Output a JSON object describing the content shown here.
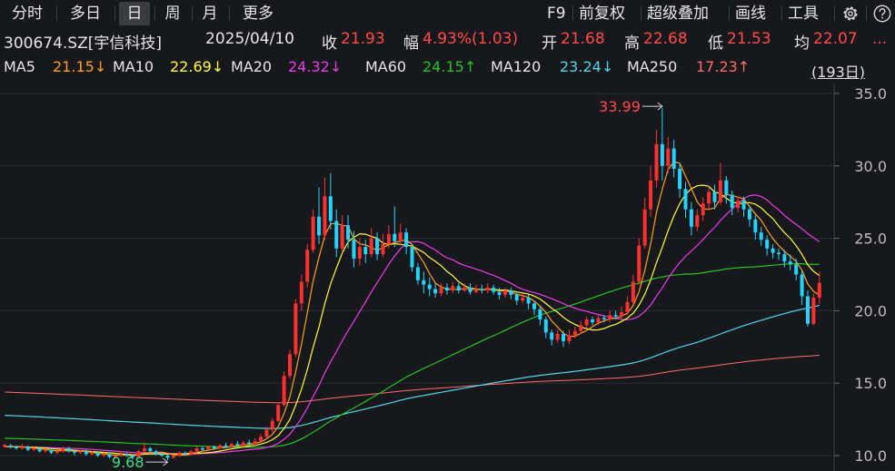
{
  "toolbar": {
    "tabs": [
      {
        "label": "分时",
        "active": false
      },
      {
        "label": "多日",
        "active": false
      },
      {
        "label": "日",
        "active": true
      },
      {
        "label": "周",
        "active": false
      },
      {
        "label": "月",
        "active": false
      },
      {
        "label": "更多",
        "active": false
      }
    ],
    "right": {
      "f9": "F9",
      "adjust": "前复权",
      "overlay": "超级叠加",
      "draw": "画线",
      "tools": "工具",
      "settings_icon": "gear-icon",
      "help_icon": "question-icon"
    }
  },
  "quote": {
    "symbol": "300674.SZ[宇信科技]",
    "date": "2025/04/10",
    "close_label": "收",
    "close": "21.93",
    "change_label": "幅",
    "change": "4.93%(1.03)",
    "open_label": "开",
    "open": "21.68",
    "high_label": "高",
    "high": "22.68",
    "low_label": "低",
    "low": "21.53",
    "avg_label": "均",
    "avg": "22.07",
    "more": "..."
  },
  "ma": [
    {
      "label": "MA5",
      "value": "21.15",
      "dir": "↓",
      "color": "#ff9f1a"
    },
    {
      "label": "MA10",
      "value": "22.69",
      "dir": "↓",
      "color": "#ffff33"
    },
    {
      "label": "MA20",
      "value": "24.32",
      "dir": "↓",
      "color": "#e83ce8"
    },
    {
      "label": "MA60",
      "value": "24.15",
      "dir": "↑",
      "color": "#22c322"
    },
    {
      "label": "MA120",
      "value": "23.24",
      "dir": "↓",
      "color": "#4fd6e8"
    },
    {
      "label": "MA250",
      "value": "17.23",
      "dir": "↑",
      "color": "#ff6b6b"
    }
  ],
  "period_label": "(193日)",
  "colors": {
    "up": "#ff3030",
    "down": "#22d4ff",
    "background": "#17181c",
    "text": "#d9d9d9"
  },
  "chart_data": {
    "type": "candlestick",
    "y_ticks": [
      "35.0",
      "30.0",
      "25.0",
      "20.0",
      "15.0",
      "10.0"
    ],
    "ylim": [
      9.5,
      35.5
    ],
    "max_annotation": "33.99",
    "min_annotation": "9.68",
    "grid": true,
    "candles": [
      [
        10.6,
        10.75,
        10.6,
        10.8
      ],
      [
        10.7,
        10.6,
        10.5,
        10.8
      ],
      [
        10.6,
        10.5,
        10.4,
        10.7
      ],
      [
        10.5,
        10.6,
        10.4,
        10.8
      ],
      [
        10.6,
        10.4,
        10.3,
        10.7
      ],
      [
        10.4,
        10.5,
        10.3,
        10.6
      ],
      [
        10.5,
        10.3,
        10.2,
        10.6
      ],
      [
        10.3,
        10.4,
        10.2,
        10.5
      ],
      [
        10.4,
        10.2,
        10.1,
        10.5
      ],
      [
        10.2,
        10.3,
        10.1,
        10.4
      ],
      [
        10.3,
        10.5,
        10.2,
        10.6
      ],
      [
        10.5,
        10.3,
        10.2,
        10.6
      ],
      [
        10.3,
        10.2,
        10.0,
        10.4
      ],
      [
        10.2,
        10.3,
        10.1,
        10.4
      ],
      [
        10.3,
        10.1,
        10.0,
        10.4
      ],
      [
        10.1,
        10.2,
        10.0,
        10.3
      ],
      [
        10.2,
        10.0,
        9.9,
        10.3
      ],
      [
        10.0,
        10.1,
        9.9,
        10.2
      ],
      [
        10.1,
        9.9,
        9.8,
        10.2
      ],
      [
        9.9,
        10.0,
        9.8,
        10.1
      ],
      [
        10.0,
        10.1,
        9.9,
        10.3
      ],
      [
        10.1,
        10.0,
        9.9,
        10.2
      ],
      [
        10.0,
        9.9,
        9.7,
        10.1
      ],
      [
        9.9,
        10.3,
        9.8,
        10.4
      ],
      [
        10.3,
        10.5,
        10.2,
        10.9
      ],
      [
        10.5,
        10.3,
        10.2,
        10.6
      ],
      [
        10.3,
        10.1,
        10.0,
        10.4
      ],
      [
        10.1,
        10.0,
        9.9,
        10.2
      ],
      [
        10.0,
        9.85,
        9.68,
        10.1
      ],
      [
        9.85,
        10.0,
        9.8,
        10.1
      ],
      [
        10.0,
        10.2,
        9.9,
        10.3
      ],
      [
        10.2,
        10.1,
        10.0,
        10.3
      ],
      [
        10.1,
        10.3,
        10.0,
        10.4
      ],
      [
        10.3,
        10.5,
        10.2,
        10.6
      ],
      [
        10.5,
        10.4,
        10.3,
        10.6
      ],
      [
        10.4,
        10.6,
        10.3,
        10.7
      ],
      [
        10.6,
        10.5,
        10.4,
        10.7
      ],
      [
        10.5,
        10.7,
        10.4,
        10.8
      ],
      [
        10.7,
        10.6,
        10.5,
        10.9
      ],
      [
        10.6,
        10.8,
        10.5,
        10.9
      ],
      [
        10.8,
        10.7,
        10.6,
        11.0
      ],
      [
        10.7,
        10.9,
        10.6,
        11.0
      ],
      [
        10.9,
        10.8,
        10.7,
        11.1
      ],
      [
        10.8,
        11.0,
        10.7,
        11.2
      ],
      [
        11.0,
        11.3,
        10.9,
        11.5
      ],
      [
        11.3,
        11.8,
        11.2,
        12.0
      ],
      [
        11.8,
        12.4,
        11.6,
        12.6
      ],
      [
        12.4,
        13.5,
        12.3,
        13.7
      ],
      [
        13.5,
        15.5,
        13.4,
        15.8
      ],
      [
        15.5,
        17.0,
        15.3,
        17.3
      ],
      [
        17.0,
        20.5,
        16.8,
        20.8
      ],
      [
        20.5,
        22.0,
        20.0,
        22.5
      ],
      [
        22.0,
        24.2,
        21.6,
        24.6
      ],
      [
        24.2,
        26.5,
        24.0,
        27.0
      ],
      [
        26.5,
        25.2,
        24.6,
        28.5
      ],
      [
        25.2,
        27.9,
        24.9,
        29.2
      ],
      [
        27.9,
        26.2,
        25.6,
        29.5
      ],
      [
        26.2,
        24.3,
        23.7,
        27.0
      ],
      [
        24.3,
        25.9,
        24.0,
        26.6
      ],
      [
        25.9,
        24.9,
        24.3,
        26.6
      ],
      [
        24.9,
        23.6,
        23.0,
        25.5
      ],
      [
        23.6,
        24.4,
        23.1,
        25.0
      ],
      [
        24.4,
        23.9,
        23.3,
        24.9
      ],
      [
        23.9,
        25.0,
        23.7,
        25.7
      ],
      [
        25.0,
        23.9,
        23.5,
        25.4
      ],
      [
        23.9,
        24.6,
        23.7,
        25.3
      ],
      [
        24.6,
        25.3,
        24.3,
        25.9
      ],
      [
        25.3,
        24.8,
        24.4,
        27.2
      ],
      [
        24.8,
        25.4,
        24.5,
        26.0
      ],
      [
        25.4,
        24.4,
        23.9,
        25.7
      ],
      [
        24.4,
        23.0,
        22.7,
        24.6
      ],
      [
        23.0,
        22.1,
        21.8,
        23.3
      ],
      [
        22.1,
        21.8,
        21.2,
        22.7
      ],
      [
        21.8,
        21.5,
        21.0,
        22.3
      ],
      [
        21.5,
        21.2,
        20.9,
        21.9
      ],
      [
        21.2,
        21.6,
        21.0,
        21.9
      ],
      [
        21.6,
        21.4,
        21.1,
        21.9
      ],
      [
        21.4,
        21.7,
        21.2,
        22.0
      ],
      [
        21.7,
        21.4,
        21.2,
        21.9
      ],
      [
        21.4,
        21.6,
        21.3,
        21.9
      ],
      [
        21.6,
        21.3,
        21.1,
        21.9
      ],
      [
        21.3,
        21.5,
        21.2,
        21.8
      ],
      [
        21.5,
        21.4,
        21.2,
        21.8
      ],
      [
        21.4,
        21.6,
        21.2,
        21.9
      ],
      [
        21.6,
        21.3,
        21.1,
        21.8
      ],
      [
        21.3,
        21.1,
        20.8,
        21.6
      ],
      [
        21.1,
        21.4,
        20.9,
        21.6
      ],
      [
        21.4,
        21.1,
        20.8,
        21.6
      ],
      [
        21.1,
        20.7,
        20.4,
        21.3
      ],
      [
        20.7,
        20.9,
        20.5,
        21.2
      ],
      [
        20.9,
        20.5,
        20.1,
        21.1
      ],
      [
        20.5,
        20.1,
        19.7,
        20.7
      ],
      [
        20.1,
        19.4,
        19.0,
        20.3
      ],
      [
        19.4,
        18.5,
        18.1,
        19.6
      ],
      [
        18.5,
        18.0,
        17.6,
        18.7
      ],
      [
        18.0,
        18.4,
        17.8,
        18.7
      ],
      [
        18.4,
        17.9,
        17.5,
        18.6
      ],
      [
        17.9,
        18.3,
        17.7,
        18.7
      ],
      [
        18.3,
        18.6,
        18.1,
        18.9
      ],
      [
        18.6,
        19.0,
        18.4,
        19.3
      ],
      [
        19.0,
        19.4,
        18.8,
        19.6
      ],
      [
        19.4,
        19.2,
        19.0,
        19.6
      ],
      [
        19.2,
        19.5,
        19.0,
        19.8
      ],
      [
        19.5,
        19.4,
        19.2,
        19.7
      ],
      [
        19.4,
        19.7,
        19.2,
        20.0
      ],
      [
        19.7,
        19.6,
        19.4,
        20.0
      ],
      [
        19.6,
        19.9,
        19.4,
        20.3
      ],
      [
        19.9,
        20.6,
        19.7,
        21.0
      ],
      [
        20.6,
        22.0,
        20.4,
        22.5
      ],
      [
        22.0,
        24.5,
        21.8,
        25.0
      ],
      [
        24.5,
        27.0,
        24.3,
        27.8
      ],
      [
        27.0,
        29.0,
        26.5,
        30.0
      ],
      [
        29.0,
        31.5,
        28.5,
        32.5
      ],
      [
        31.5,
        30.0,
        29.0,
        33.99
      ],
      [
        30.0,
        31.2,
        29.5,
        32.0
      ],
      [
        31.2,
        29.8,
        29.2,
        31.8
      ],
      [
        29.8,
        28.4,
        27.8,
        30.2
      ],
      [
        28.4,
        27.0,
        26.4,
        28.9
      ],
      [
        27.0,
        25.8,
        25.2,
        27.5
      ],
      [
        25.8,
        26.6,
        25.5,
        27.0
      ],
      [
        26.6,
        27.4,
        26.2,
        27.8
      ],
      [
        27.4,
        28.2,
        27.0,
        28.6
      ],
      [
        28.2,
        27.5,
        27.0,
        28.7
      ],
      [
        27.5,
        29.0,
        27.3,
        30.2
      ],
      [
        29.0,
        28.0,
        27.4,
        29.3
      ],
      [
        28.0,
        27.1,
        26.6,
        28.3
      ],
      [
        27.1,
        27.6,
        26.8,
        27.9
      ],
      [
        27.6,
        27.0,
        26.5,
        27.9
      ],
      [
        27.0,
        26.3,
        25.8,
        27.3
      ],
      [
        26.3,
        25.4,
        24.9,
        26.6
      ],
      [
        25.4,
        24.9,
        24.5,
        25.8
      ],
      [
        24.9,
        24.3,
        23.8,
        25.2
      ],
      [
        24.3,
        24.0,
        23.6,
        24.6
      ],
      [
        24.0,
        23.9,
        23.5,
        24.3
      ],
      [
        23.9,
        23.4,
        23.0,
        24.2
      ],
      [
        23.4,
        23.2,
        22.8,
        23.9
      ],
      [
        23.2,
        22.5,
        22.1,
        23.6
      ],
      [
        22.5,
        21.0,
        20.4,
        22.8
      ],
      [
        21.0,
        19.1,
        18.9,
        21.4
      ],
      [
        19.1,
        20.9,
        19.0,
        21.2
      ],
      [
        20.9,
        21.93,
        20.5,
        22.68
      ]
    ]
  }
}
